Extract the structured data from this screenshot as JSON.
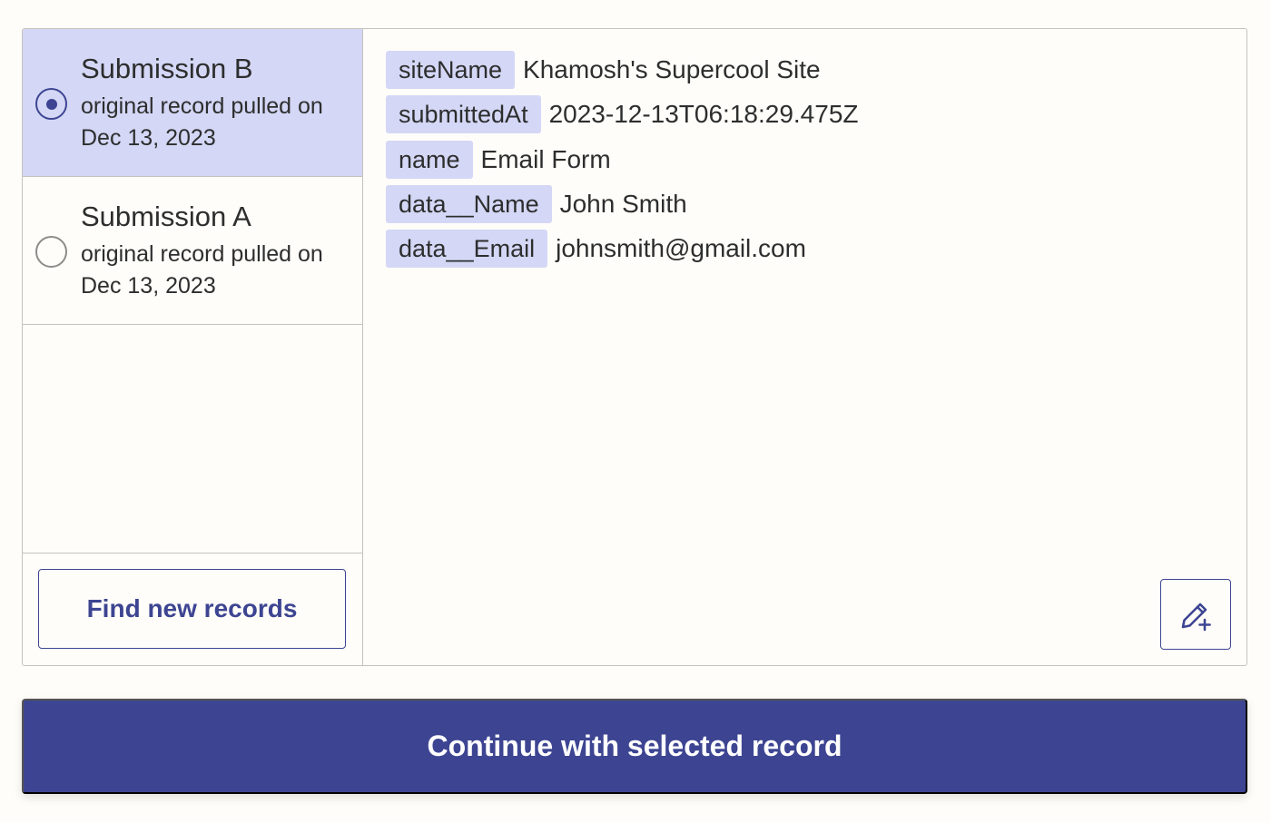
{
  "records": [
    {
      "title": "Submission B",
      "subtitle_line1": "original record pulled on",
      "subtitle_line2": "Dec 13, 2023",
      "selected": true
    },
    {
      "title": "Submission A",
      "subtitle_line1": "original record pulled on",
      "subtitle_line2": "Dec 13, 2023",
      "selected": false
    }
  ],
  "sidebar": {
    "find_button_label": "Find new records"
  },
  "details": {
    "fields": [
      {
        "key": "siteName",
        "value": "Khamosh's Supercool Site"
      },
      {
        "key": "submittedAt",
        "value": "2023-12-13T06:18:29.475Z"
      },
      {
        "key": "name",
        "value": "Email Form"
      },
      {
        "key": "data__Name",
        "value": "John Smith"
      },
      {
        "key": "data__Email",
        "value": "johnsmith@gmail.com"
      }
    ],
    "edit_icon": "pencil-plus-icon"
  },
  "footer": {
    "continue_label": "Continue with selected record"
  },
  "colors": {
    "accent": "#3d4592",
    "selected_bg": "#d4d7f5",
    "key_chip_bg": "#d4d7f5",
    "page_bg": "#fffdf9",
    "border": "#c5c3bd"
  }
}
